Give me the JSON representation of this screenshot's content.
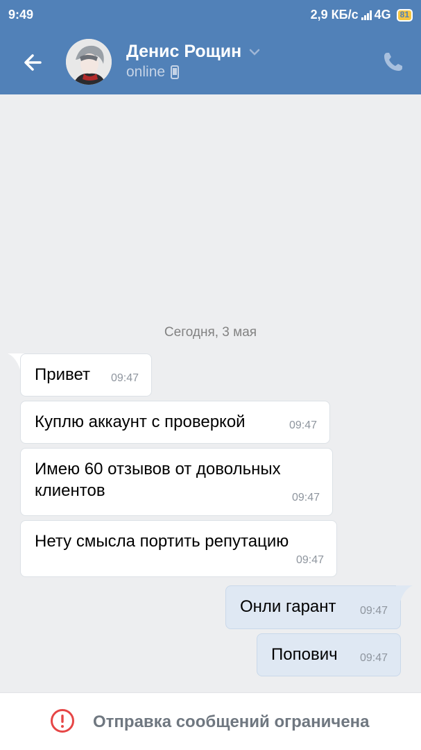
{
  "status_bar": {
    "time": "9:49",
    "network_speed": "2,9 КБ/с",
    "network_type": "4G",
    "battery": "81"
  },
  "header": {
    "contact_name": "Денис Рощин",
    "status": "online",
    "background_color": "#5181b8"
  },
  "chat": {
    "date_separator": "Сегодня, 3 мая",
    "messages": [
      {
        "text": "Привет",
        "time": "09:47",
        "direction": "incoming"
      },
      {
        "text": "Куплю аккаунт с проверкой",
        "time": "09:47",
        "direction": "incoming"
      },
      {
        "text": "Имею 60 отзывов от довольных клиентов",
        "time": "09:47",
        "direction": "incoming"
      },
      {
        "text": "Нету смысла портить репутацию",
        "time": "09:47",
        "direction": "incoming"
      },
      {
        "text": "Онли гарант",
        "time": "09:47",
        "direction": "outgoing"
      },
      {
        "text": "Попович",
        "time": "09:47",
        "direction": "outgoing"
      }
    ]
  },
  "footer": {
    "restriction_text": "Отправка сообщений ограничена",
    "icon": "exclamation-circle-icon",
    "icon_color": "#e64646"
  }
}
